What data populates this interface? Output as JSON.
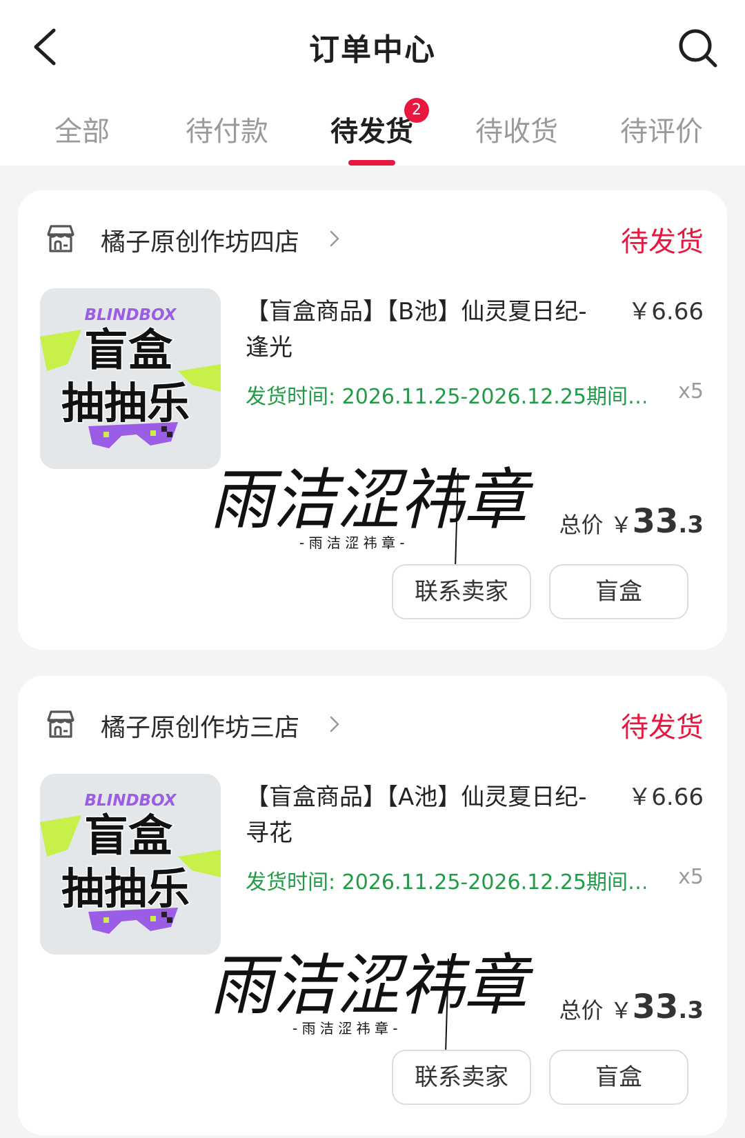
{
  "header": {
    "title": "订单中心"
  },
  "tabs": [
    {
      "label": "全部"
    },
    {
      "label": "待付款"
    },
    {
      "label": "待发货",
      "badge": "2"
    },
    {
      "label": "待收货"
    },
    {
      "label": "待评价"
    }
  ],
  "colors": {
    "accent": "#e8173f",
    "ship_time": "#1f9c45"
  },
  "orders": [
    {
      "shop_name": "橘子原创作坊四店",
      "status": "待发货",
      "product_title": "【盲盒商品】【B池】仙灵夏日纪-逢光",
      "price": "￥6.66",
      "ship_time": "发货时间: 2026.11.25-2026.12.25期间…",
      "quantity": "x5",
      "total_label": "总价 ￥",
      "total_int": "33",
      "total_dec": ".3",
      "buttons": {
        "contact": "联系卖家",
        "blindbox": "盲盒"
      },
      "thumb": {
        "brand": "BLINDBOX",
        "line1": "盲盒",
        "line2": "抽抽乐"
      },
      "signature": {
        "main": "雨洁涩祎章",
        "sub": "- 雨 洁 涩 祎 章 -"
      }
    },
    {
      "shop_name": "橘子原创作坊三店",
      "status": "待发货",
      "product_title": "【盲盒商品】【A池】仙灵夏日纪-寻花",
      "price": "￥6.66",
      "ship_time": "发货时间: 2026.11.25-2026.12.25期间…",
      "quantity": "x5",
      "total_label": "总价 ￥",
      "total_int": "33",
      "total_dec": ".3",
      "buttons": {
        "contact": "联系卖家",
        "blindbox": "盲盒"
      },
      "thumb": {
        "brand": "BLINDBOX",
        "line1": "盲盒",
        "line2": "抽抽乐"
      },
      "signature": {
        "main": "雨洁涩祎章",
        "sub": "- 雨 洁 涩 祎 章 -"
      }
    }
  ]
}
